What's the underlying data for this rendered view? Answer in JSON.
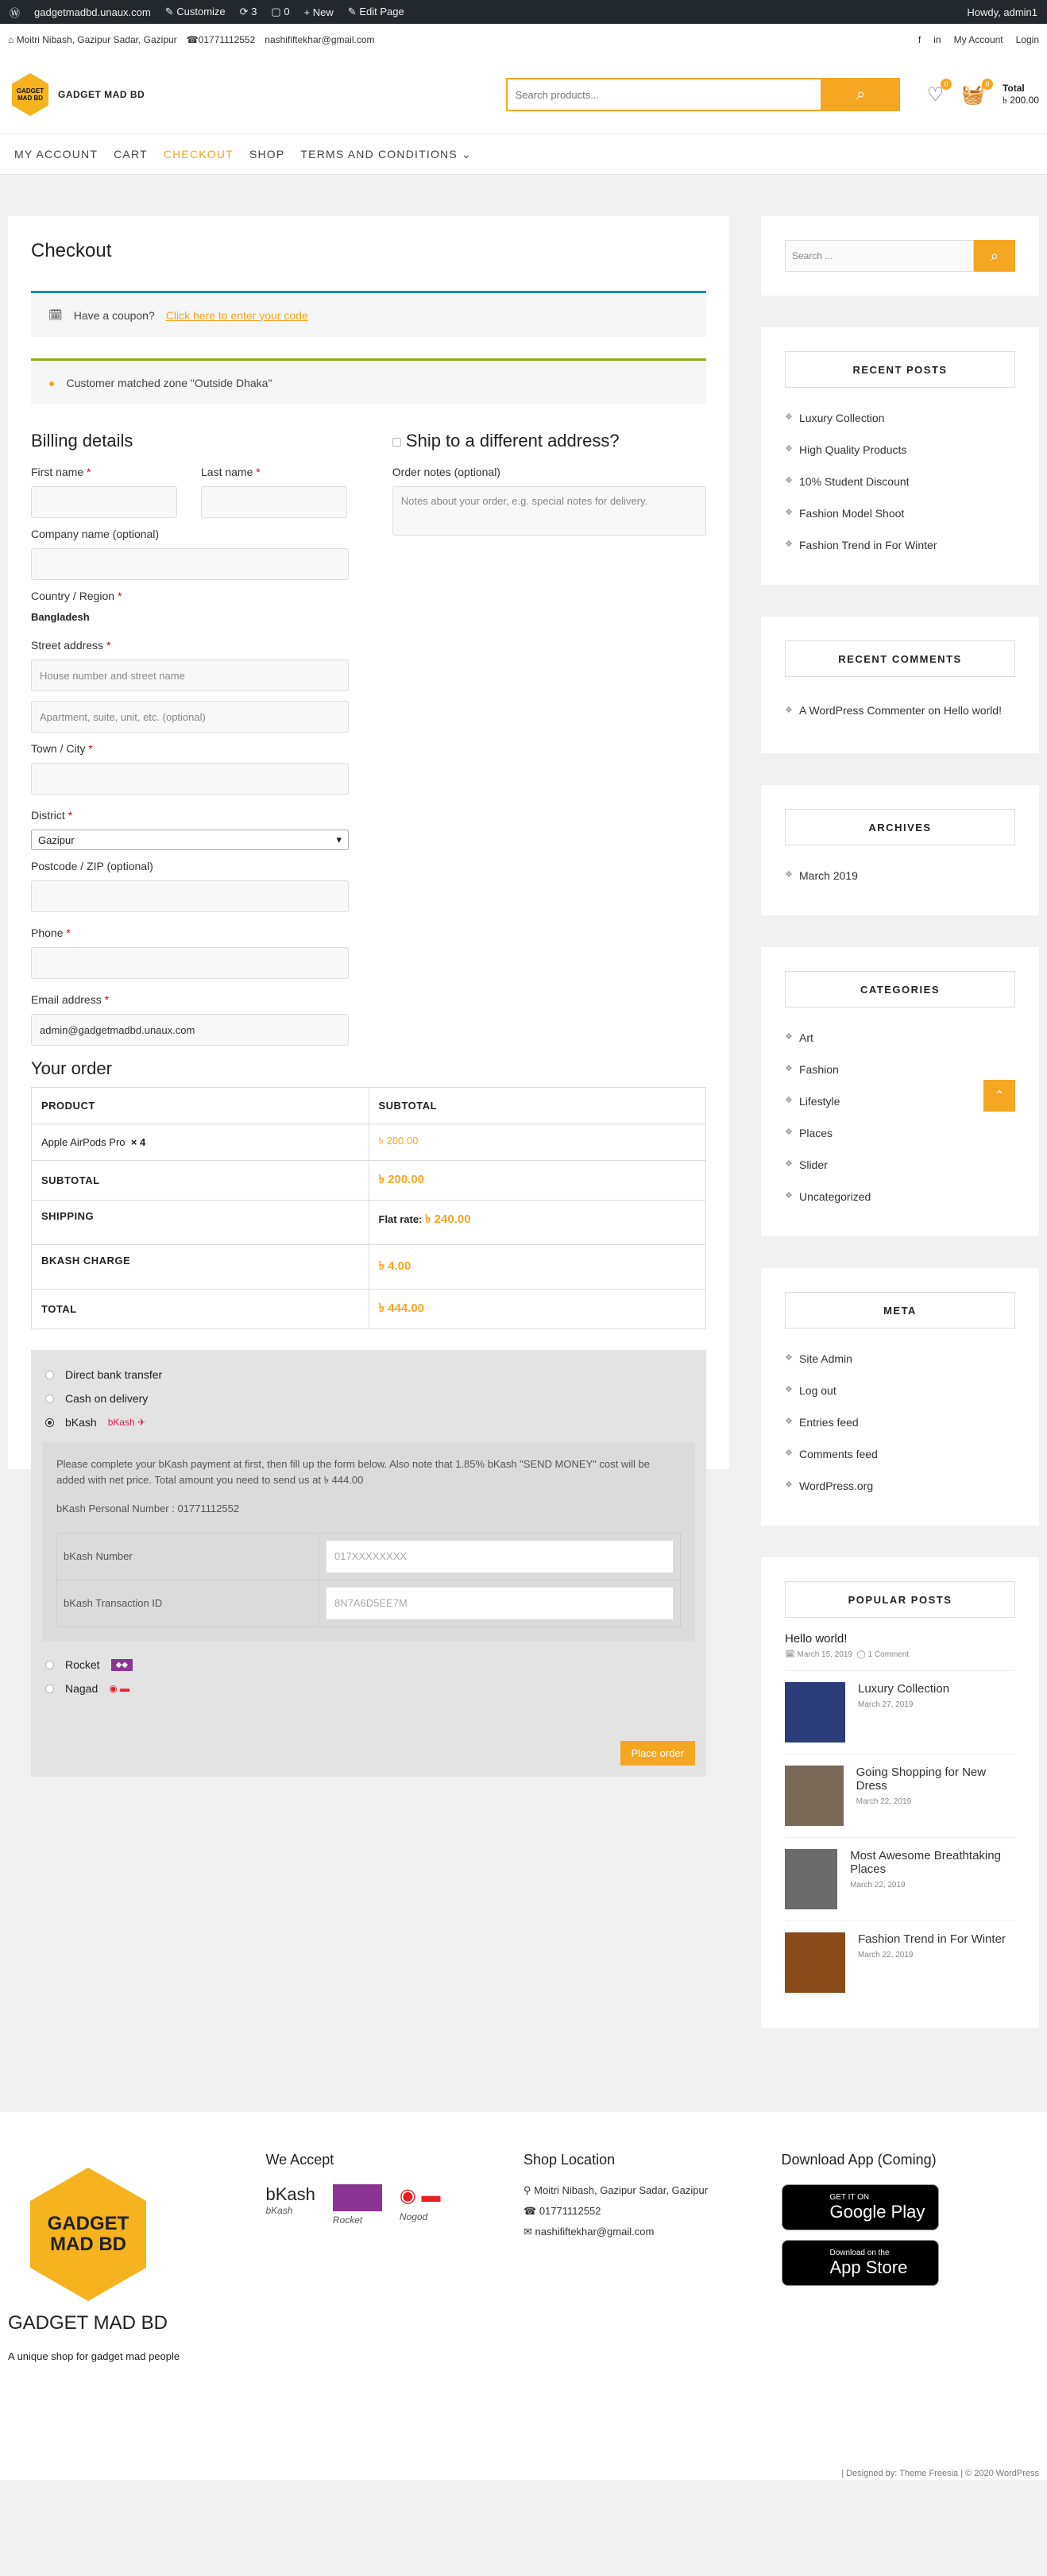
{
  "adminbar": {
    "site": "gadgetmadbd.unaux.com",
    "customize": "Customize",
    "updates": "3",
    "comments": "0",
    "new": "New",
    "edit": "Edit Page",
    "howdy": "Howdy, admin1"
  },
  "topinfo": {
    "address": "Moitri Nibash, Gazipur Sadar, Gazipur",
    "phone": "01771112552",
    "email": "nashififtekhar@gmail.com",
    "account": "My Account",
    "login": "Login"
  },
  "header": {
    "logo_text": "GADGET MAD BD",
    "logo_small": "GADGET MAD BD",
    "search_placeholder": "Search products...",
    "wishlist_count": "0",
    "cart_count": "0",
    "total_label": "Total",
    "total_value": "৳ 200.00"
  },
  "nav": [
    "MY ACCOUNT",
    "CART",
    "CHECKOUT",
    "SHOP",
    "TERMS AND CONDITIONS ⌄"
  ],
  "checkout": {
    "title": "Checkout",
    "coupon_text": "Have a coupon?",
    "coupon_link": "Click here to enter your code",
    "zone_text": "Customer matched zone \"Outside Dhaka\"",
    "billing_title": "Billing details",
    "first_name": "First name",
    "last_name": "Last name",
    "company": "Company name (optional)",
    "country_label": "Country / Region",
    "country": "Bangladesh",
    "street_label": "Street address",
    "street_ph": "House number and street name",
    "apt_ph": "Apartment, suite, unit, etc. (optional)",
    "town_label": "Town / City",
    "district_label": "District",
    "district": "Gazipur",
    "postcode_label": "Postcode / ZIP (optional)",
    "phone_label": "Phone",
    "email_label": "Email address",
    "email": "admin@gadgetmadbd.unaux.com",
    "ship_title": "Ship to a different address?",
    "notes_label": "Order notes (optional)",
    "notes_ph": "Notes about your order, e.g. special notes for delivery.",
    "order_title": "Your order",
    "th_product": "PRODUCT",
    "th_subtotal": "SUBTOTAL",
    "product": "Apple AirPods Pro",
    "qty": "× 4",
    "product_price": "৳ 200.00",
    "subtotal_label": "SUBTOTAL",
    "subtotal": "৳ 200.00",
    "shipping_label": "SHIPPING",
    "shipping_prefix": "Flat rate:",
    "shipping": "৳ 240.00",
    "bkash_label": "BKASH CHARGE",
    "bkash": "৳ 4.00",
    "total_label": "TOTAL",
    "total": "৳ 444.00",
    "pm1": "Direct bank transfer",
    "pm2": "Cash on delivery",
    "pm3": "bKash",
    "pm4": "Rocket",
    "pm5": "Nagad",
    "bkash_note": "Please complete your bKash payment at first, then fill up the form below. Also note that 1.85% bKash \"SEND MONEY\" cost will be added with net price. Total amount you need to send us at ৳ 444.00",
    "bkash_personal": "bKash Personal Number : 01771112552",
    "bk_num_label": "bKash Number",
    "bk_num_ph": "017XXXXXXXX",
    "bk_tx_label": "bKash Transaction ID",
    "bk_tx_ph": "8N7A6D5EE7M",
    "place": "Place order"
  },
  "sidebar": {
    "search_ph": "Search ...",
    "recent_posts_title": "RECENT POSTS",
    "recent_posts": [
      "Luxury Collection",
      "High Quality Products",
      "10% Student Discount",
      "Fashion Model Shoot",
      "Fashion Trend in For Winter"
    ],
    "recent_comments_title": "RECENT COMMENTS",
    "comment_author": "A WordPress Commenter",
    "comment_on": "on",
    "comment_post": "Hello world!",
    "archives_title": "ARCHIVES",
    "archives": [
      "March 2019"
    ],
    "categories_title": "CATEGORIES",
    "categories": [
      "Art",
      "Fashion",
      "Lifestyle",
      "Places",
      "Slider",
      "Uncategorized"
    ],
    "meta_title": "META",
    "meta": [
      "Site Admin",
      "Log out",
      "Entries feed",
      "Comments feed",
      "WordPress.org"
    ],
    "popular_title": "POPULAR POSTS",
    "pop0_title": "Hello world!",
    "pop0_date": "March 15, 2019",
    "pop0_comments": "1 Comment",
    "popular": [
      {
        "t": "Luxury Collection",
        "d": "March 27, 2019"
      },
      {
        "t": "Going Shopping for New Dress",
        "d": "March 22, 2019"
      },
      {
        "t": "Most Awesome Breathtaking Places",
        "d": "March 22, 2019"
      },
      {
        "t": "Fashion Trend in For Winter",
        "d": "March 22, 2019"
      }
    ]
  },
  "footer": {
    "accept_title": "We Accept",
    "bkash": "bKash",
    "rocket": "Rocket",
    "nagad": "Nogod",
    "loc_title": "Shop Location",
    "loc_addr": "Moitri Nibash, Gazipur Sadar, Gazipur",
    "loc_phone": "01771112552",
    "loc_email": "nashififtekhar@gmail.com",
    "app_title": "Download App (Coming)",
    "gp_small": "GET IT ON",
    "gp_big": "Google Play",
    "as_small": "Download on the",
    "as_big": "App Store",
    "brand": "GADGET MAD BD",
    "logo_text": "GADGET MAD BD",
    "tagline": "A unique shop for gadget mad people",
    "copyright": "| Designed by: Theme Freesia | © 2020 WordPress"
  },
  "colors": {
    "accent": "#f5a623",
    "adminbar": "#23282d"
  }
}
